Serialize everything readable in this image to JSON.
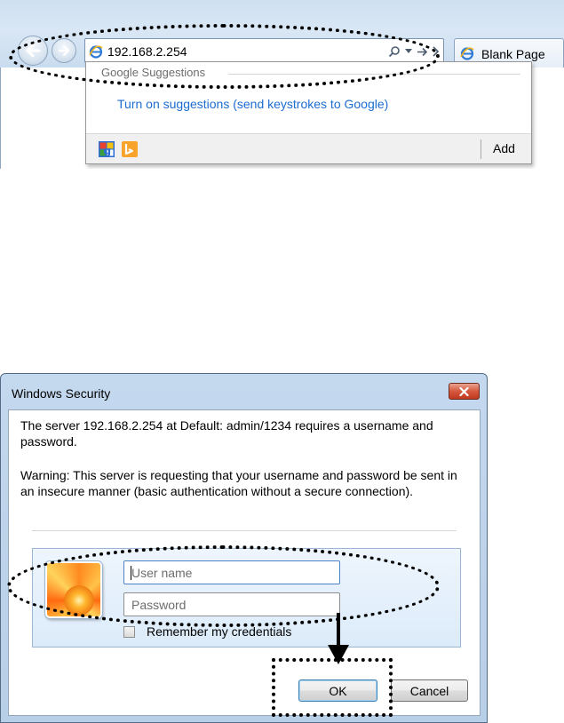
{
  "browser": {
    "address": "192.168.2.254",
    "tab_label": "Blank Page",
    "suggestions": {
      "header": "Google Suggestions",
      "link": "Turn on suggestions (send keystrokes to Google)",
      "add_label": "Add"
    }
  },
  "dialog": {
    "title": "Windows Security",
    "message": "The server 192.168.2.254 at Default: admin/1234 requires a username and password.",
    "warning": "Warning: This server is requesting that your username and password be sent in an insecure manner (basic authentication without a secure connection).",
    "username_placeholder": "User name",
    "password_placeholder": "Password",
    "remember_label": "Remember my credentials",
    "ok_label": "OK",
    "cancel_label": "Cancel"
  },
  "icons": {
    "back": "back-arrow-icon",
    "forward": "forward-arrow-icon",
    "browser": "internet-explorer-icon",
    "search": "search-icon",
    "go": "go-arrow-icon",
    "refresh": "refresh-icon",
    "google": "google-icon",
    "bing": "bing-icon",
    "close": "close-icon",
    "user": "user-tile-flower"
  },
  "colors": {
    "link": "#1c6cd1",
    "dialog_frame": "#b8cfe8",
    "close_button": "#c0391f"
  }
}
